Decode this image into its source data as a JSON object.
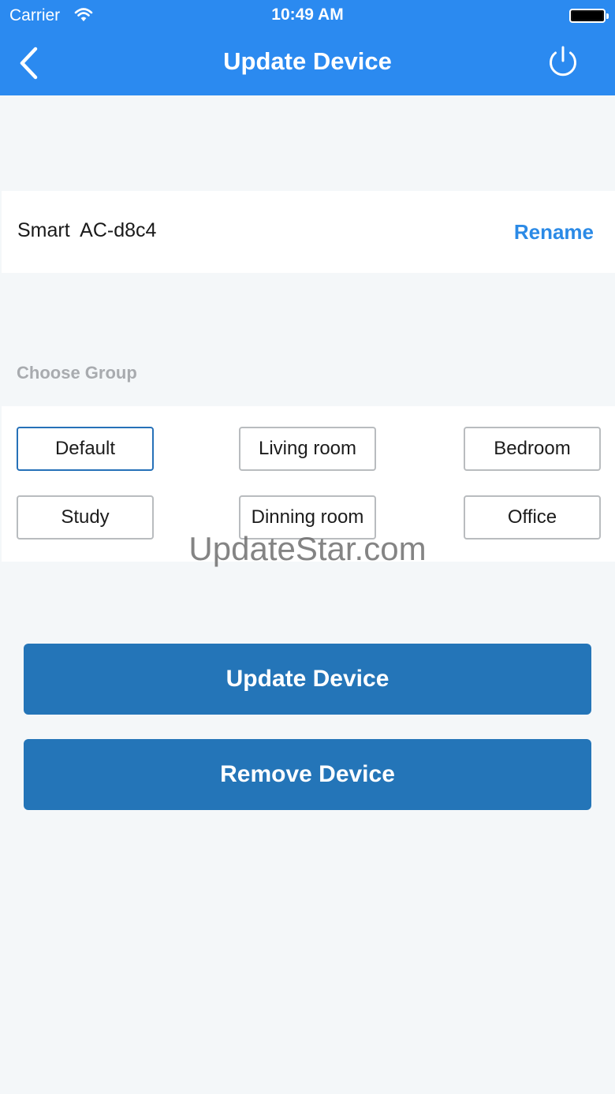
{
  "status_bar": {
    "carrier": "Carrier",
    "time": "10:49 AM"
  },
  "nav": {
    "title": "Update Device",
    "back_icon": "chevron-left-icon",
    "power_icon": "power-icon",
    "background_color": "#2b8af0"
  },
  "device": {
    "name": "Smart  AC-d8c4",
    "rename_label": "Rename"
  },
  "groups": {
    "label": "Choose Group",
    "selected": "Default",
    "options": [
      "Default",
      "Living room",
      "Bedroom",
      "Study",
      "Dinning room",
      "Office"
    ]
  },
  "watermark": "UpdateStar.com",
  "actions": {
    "update_label": "Update Device",
    "remove_label": "Remove Device",
    "button_color": "#2475b8"
  }
}
